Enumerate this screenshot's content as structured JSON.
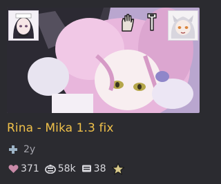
{
  "card": {
    "title": "Rina - Mika 1.3 fix",
    "age": "2y",
    "stats": {
      "likes": "371",
      "downloads": "58k",
      "comments": "38"
    }
  },
  "colors": {
    "title": "#f0c14a",
    "background": "#2b2b30",
    "heart": "#c98aa8",
    "star": "#d8c98a"
  },
  "icons": {
    "thumbnail_left_avatar": "character-avatar-icon",
    "thumbnail_mid_left": "hand-icon",
    "thumbnail_mid_right": "wrench-icon",
    "thumbnail_right_avatar": "character-avatar-icon",
    "age": "plus-icon",
    "likes": "heart-icon",
    "downloads": "download-icon",
    "comments": "comment-icon",
    "rating": "star-icon"
  }
}
